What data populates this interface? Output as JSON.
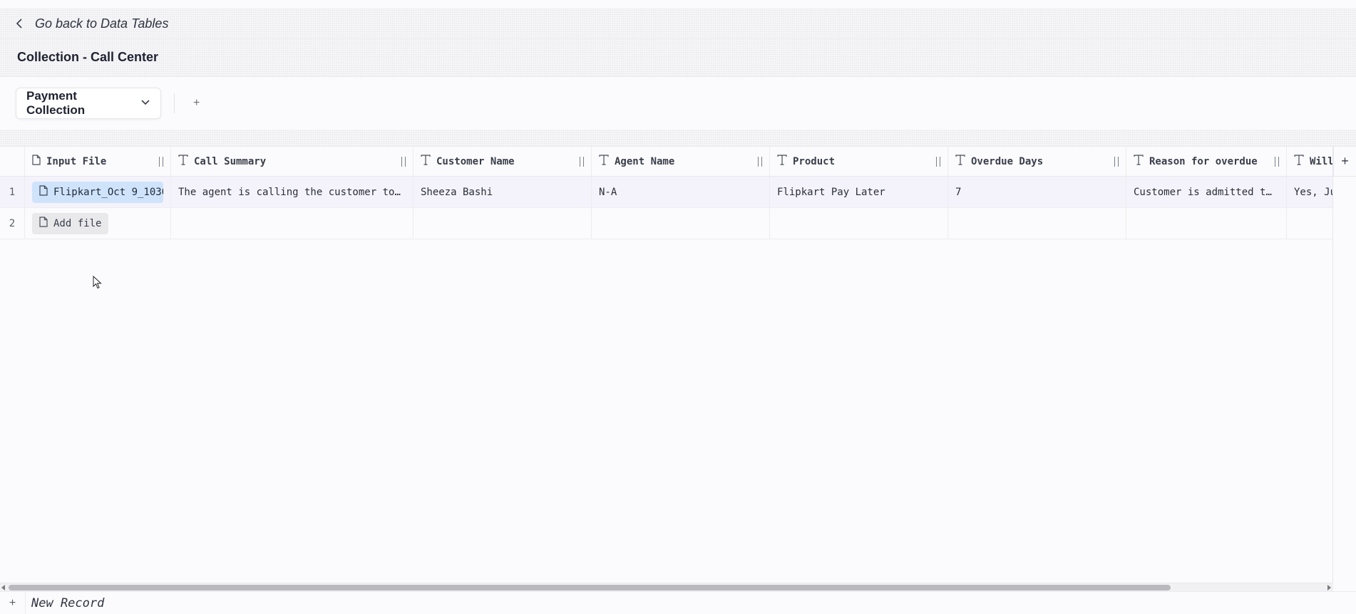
{
  "nav": {
    "back_label": "Go back to Data Tables"
  },
  "page": {
    "title": "Collection - Call Center"
  },
  "tabs": {
    "selected": "Payment Collection",
    "add_label": "+"
  },
  "table": {
    "columns": [
      {
        "label": "Input File",
        "icon": "file-icon"
      },
      {
        "label": "Call Summary",
        "icon": "text-type-icon"
      },
      {
        "label": "Customer Name",
        "icon": "text-type-icon"
      },
      {
        "label": "Agent Name",
        "icon": "text-type-icon"
      },
      {
        "label": "Product",
        "icon": "text-type-icon"
      },
      {
        "label": "Overdue Days",
        "icon": "text-type-icon"
      },
      {
        "label": "Reason for overdue",
        "icon": "text-type-icon"
      },
      {
        "label": "Will",
        "icon": "text-type-icon"
      }
    ],
    "add_column_label": "+",
    "rows": [
      {
        "number": "1",
        "file": "Flipkart_Oct 9_1030",
        "cells": [
          "The agent is calling the customer to …",
          "Sheeza Bashi",
          "N-A",
          "Flipkart Pay Later",
          "7",
          "Customer is admitted to…",
          "Yes, Ju"
        ]
      },
      {
        "number": "2",
        "add_file_label": "Add file",
        "cells": [
          "",
          "",
          "",
          "",
          "",
          "",
          ""
        ]
      }
    ]
  },
  "footer": {
    "plus": "+",
    "new_record_label": "New Record"
  },
  "colors": {
    "selected_row": "#f4f3fb",
    "file_chip": "#cfe3fb",
    "add_file": "#e9e9ec"
  }
}
